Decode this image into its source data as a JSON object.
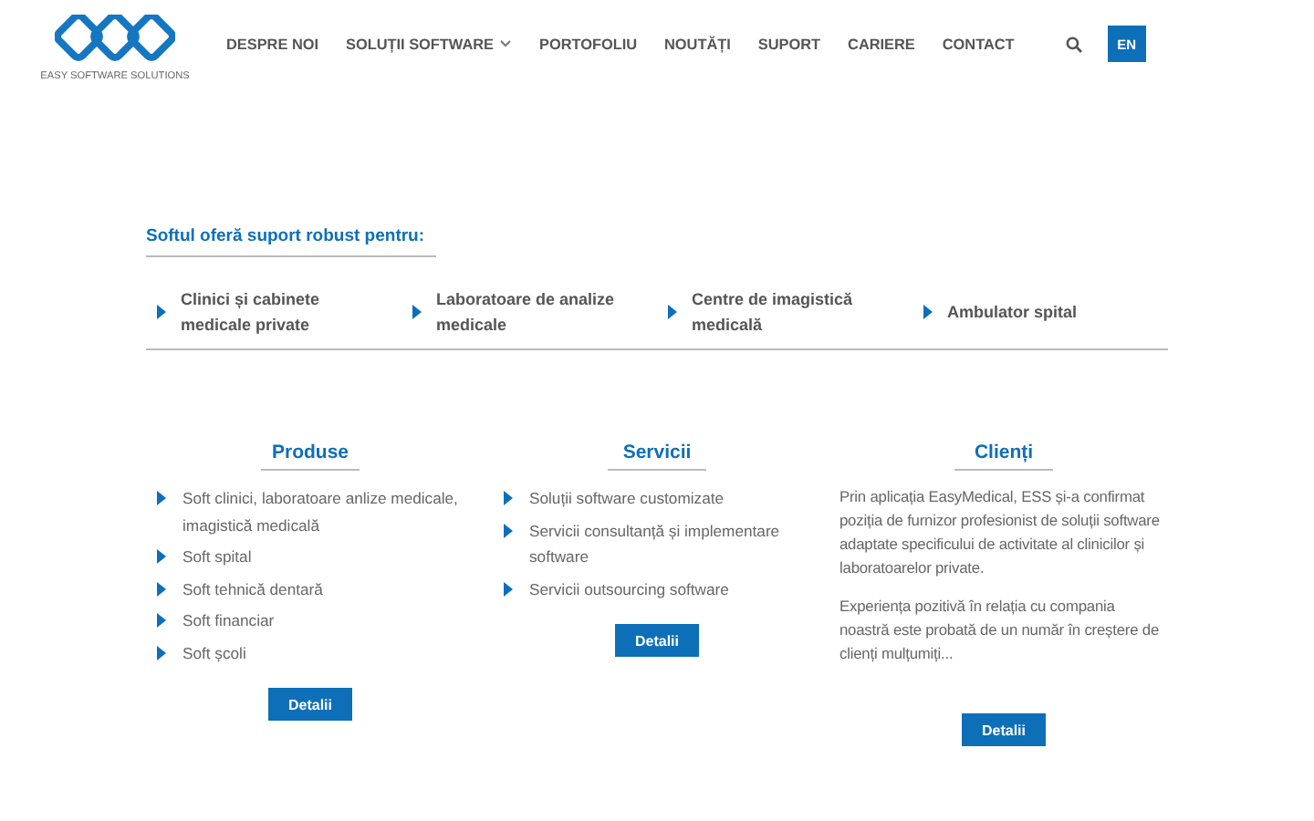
{
  "header": {
    "logo_caption": "EASY SOFTWARE SOLUTIONS",
    "nav": [
      {
        "label": "DESPRE NOI",
        "dropdown": false
      },
      {
        "label": "SOLUȚII SOFTWARE",
        "dropdown": true
      },
      {
        "label": "PORTOFOLIU",
        "dropdown": false
      },
      {
        "label": "NOUTĂȚI",
        "dropdown": false
      },
      {
        "label": "SUPORT",
        "dropdown": false
      },
      {
        "label": "CARIERE",
        "dropdown": false
      },
      {
        "label": "CONTACT",
        "dropdown": false
      }
    ],
    "language": "EN"
  },
  "support": {
    "title": "Softul oferă suport robust pentru:",
    "items": [
      "Clinici și cabinete medicale private",
      "Laboratoare de analize medicale",
      "Centre de imagistică medicală",
      "Ambulator spital"
    ]
  },
  "columns": [
    {
      "title": "Produse",
      "kind": "list",
      "items": [
        "Soft clinici, laboratoare anlize medicale, imagistică medicală",
        "Soft spital",
        "Soft tehnică dentară",
        "Soft financiar",
        "Soft școli"
      ],
      "button": "Detalii"
    },
    {
      "title": "Servicii",
      "kind": "list",
      "items": [
        "Soluții software customizate",
        "Servicii consultanță și implementare software",
        "Servicii outsourcing software"
      ],
      "button": "Detalii"
    },
    {
      "title": "Clienți",
      "kind": "text",
      "paragraphs": [
        "Prin aplicația EasyMedical, ESS și-a confirmat poziția de furnizor profesionist de soluții software adaptate specificului de activitate al clinicilor și laboratoarelor private.",
        "Experiența pozitivă în relația cu compania noastră este probată de un număr în creștere de clienți mulțumiți..."
      ],
      "button": "Detalii"
    }
  ]
}
